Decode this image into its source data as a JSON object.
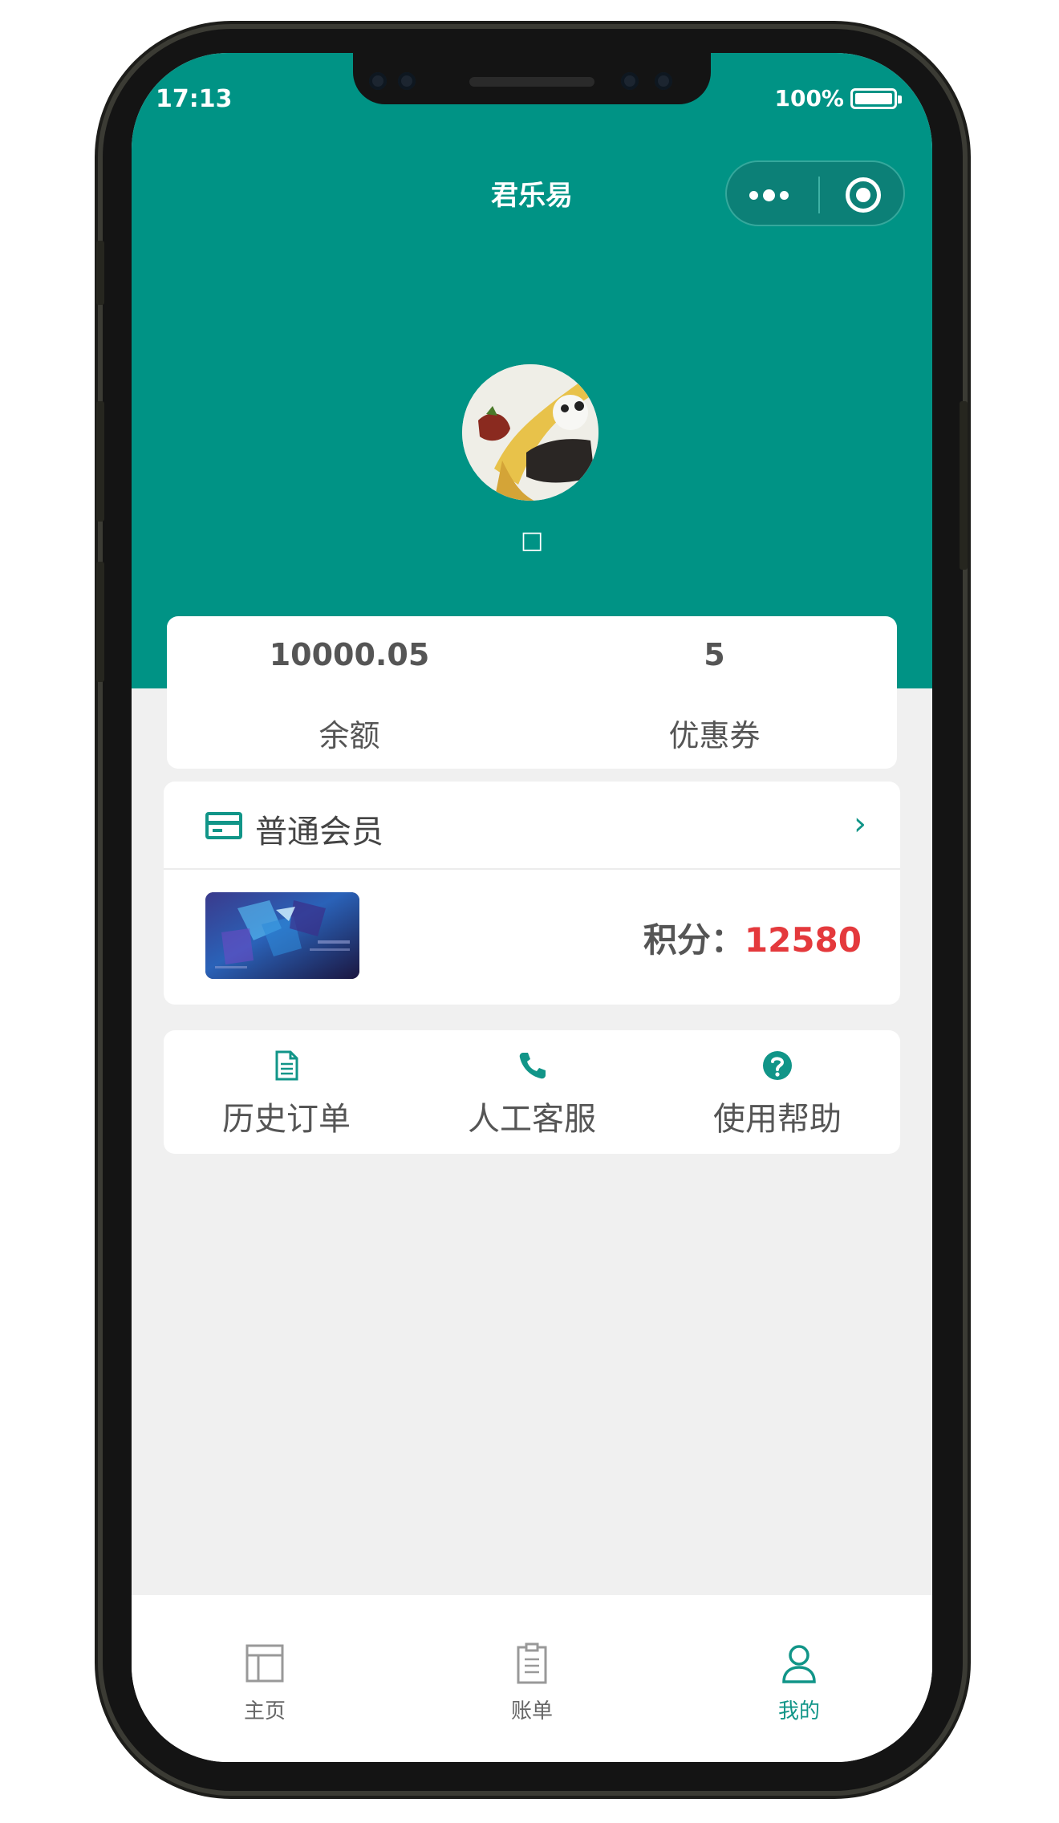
{
  "status_bar": {
    "time": "17:13",
    "battery": "100%"
  },
  "header": {
    "title": "君乐易"
  },
  "profile": {
    "name": "□"
  },
  "stats": [
    {
      "value": "10000.05",
      "label": "余额"
    },
    {
      "value": "5",
      "label": "优惠券"
    }
  ],
  "membership": {
    "level": "普通会员",
    "points_label": "积分：",
    "points_value": "12580"
  },
  "quick_actions": [
    {
      "label": "历史订单",
      "icon": "document-icon"
    },
    {
      "label": "人工客服",
      "icon": "phone-icon"
    },
    {
      "label": "使用帮助",
      "icon": "help-icon"
    }
  ],
  "tabbar": [
    {
      "label": "主页",
      "icon": "home-layout-icon"
    },
    {
      "label": "账单",
      "icon": "clipboard-icon"
    },
    {
      "label": "我的",
      "icon": "user-icon",
      "active": true
    }
  ],
  "colors": {
    "primary": "#009385",
    "accent": "#119588",
    "points": "#e4393c",
    "background": "#f0f0f0"
  }
}
